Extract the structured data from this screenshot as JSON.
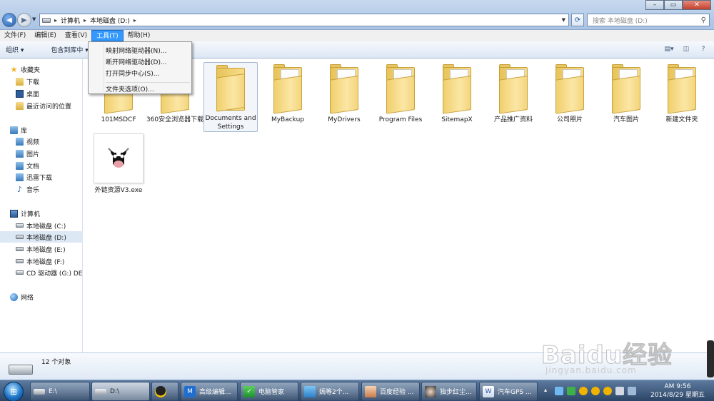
{
  "titlebar": {
    "crumbs": [
      "计算机",
      "本地磁盘 (D:)"
    ],
    "search_placeholder": "搜索 本地磁盘 (D:)"
  },
  "menubar": {
    "items": [
      "文件(F)",
      "编辑(E)",
      "查看(V)",
      "工具(T)",
      "帮助(H)"
    ],
    "active_index": 3
  },
  "toolbar": {
    "organize_label": "组织 ▾",
    "include_label": "包含到库中 ▾"
  },
  "tools_menu": {
    "items": [
      "映射网络驱动器(N)...",
      "断开网络驱动器(D)...",
      "打开同步中心(S)...",
      "文件夹选项(O)..."
    ]
  },
  "sidebar": {
    "favorites": {
      "label": "收藏夹",
      "items": [
        "下载",
        "桌面",
        "最近访问的位置"
      ]
    },
    "libraries": {
      "label": "库",
      "items": [
        "视频",
        "图片",
        "文档",
        "迅雷下载",
        "音乐"
      ]
    },
    "computer": {
      "label": "计算机",
      "items": [
        "本地磁盘 (C:)",
        "本地磁盘 (D:)",
        "本地磁盘 (E:)",
        "本地磁盘 (F:)",
        "CD 驱动器 (G:) DEE"
      ],
      "selected_index": 1
    },
    "network": {
      "label": "网络"
    }
  },
  "files": [
    {
      "name": "101MSDCF",
      "type": "folder"
    },
    {
      "name": "360安全浏览器下载",
      "type": "folder"
    },
    {
      "name": "Documents and Settings",
      "type": "folder",
      "selected": true
    },
    {
      "name": "MyBackup",
      "type": "folder"
    },
    {
      "name": "MyDrivers",
      "type": "folder"
    },
    {
      "name": "Program Files",
      "type": "folder"
    },
    {
      "name": "SitemapX",
      "type": "folder"
    },
    {
      "name": "产品推广资料",
      "type": "folder"
    },
    {
      "name": "公司照片",
      "type": "folder"
    },
    {
      "name": "汽车图片",
      "type": "folder"
    },
    {
      "name": "新建文件夹",
      "type": "folder"
    },
    {
      "name": "外链资源V3.exe",
      "type": "exe"
    }
  ],
  "status": {
    "count": "12 个对象"
  },
  "taskbar": {
    "buttons": [
      "E:\\",
      "D:\\",
      "",
      "高级编辑...",
      "电脑管家",
      "嫣等2个...",
      "百度经验 ...",
      "独步红尘...",
      "汽车GPS ..."
    ],
    "clock_time": "AM 9:56",
    "clock_date": "2014/8/29 星期五"
  },
  "watermark": {
    "text": "Baidu经验",
    "site": "jingyan.baidu.com"
  },
  "colors": {
    "menu_highlight": "#3399ff",
    "selection_bg": "#dde8f5",
    "taskbar": "#2c4566"
  }
}
